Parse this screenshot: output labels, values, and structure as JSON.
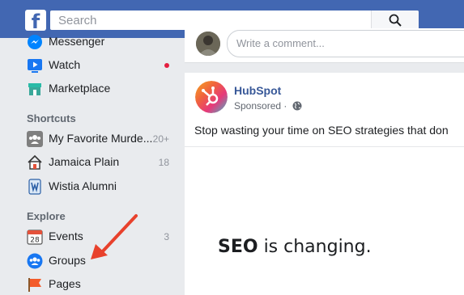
{
  "header": {
    "logo": "f",
    "search_placeholder": "Search"
  },
  "sidebar": {
    "items_top": [
      {
        "label": "Messenger",
        "icon": "messenger-icon"
      },
      {
        "label": "Watch",
        "icon": "watch-icon"
      },
      {
        "label": "Marketplace",
        "icon": "marketplace-icon"
      }
    ],
    "shortcuts_title": "Shortcuts",
    "shortcuts": [
      {
        "label": "My Favorite Murde...",
        "count": "20+"
      },
      {
        "label": "Jamaica Plain",
        "count": "18"
      },
      {
        "label": "Wistia Alumni",
        "count": ""
      }
    ],
    "explore_title": "Explore",
    "explore": [
      {
        "label": "Events",
        "count": "3",
        "icon_text": "28"
      },
      {
        "label": "Groups",
        "count": ""
      },
      {
        "label": "Pages",
        "count": ""
      }
    ]
  },
  "feed": {
    "comment_placeholder": "Write a comment...",
    "post": {
      "author": "HubSpot",
      "sponsored": "Sponsored ·",
      "text": "Stop wasting your time on SEO strategies that don",
      "headline_bold": "SEO",
      "headline_rest": " is changing."
    }
  },
  "colors": {
    "topbar": "#4267b2",
    "link": "#385898",
    "arrow": "#e8412c",
    "notification_dot": "#e41e3f"
  }
}
